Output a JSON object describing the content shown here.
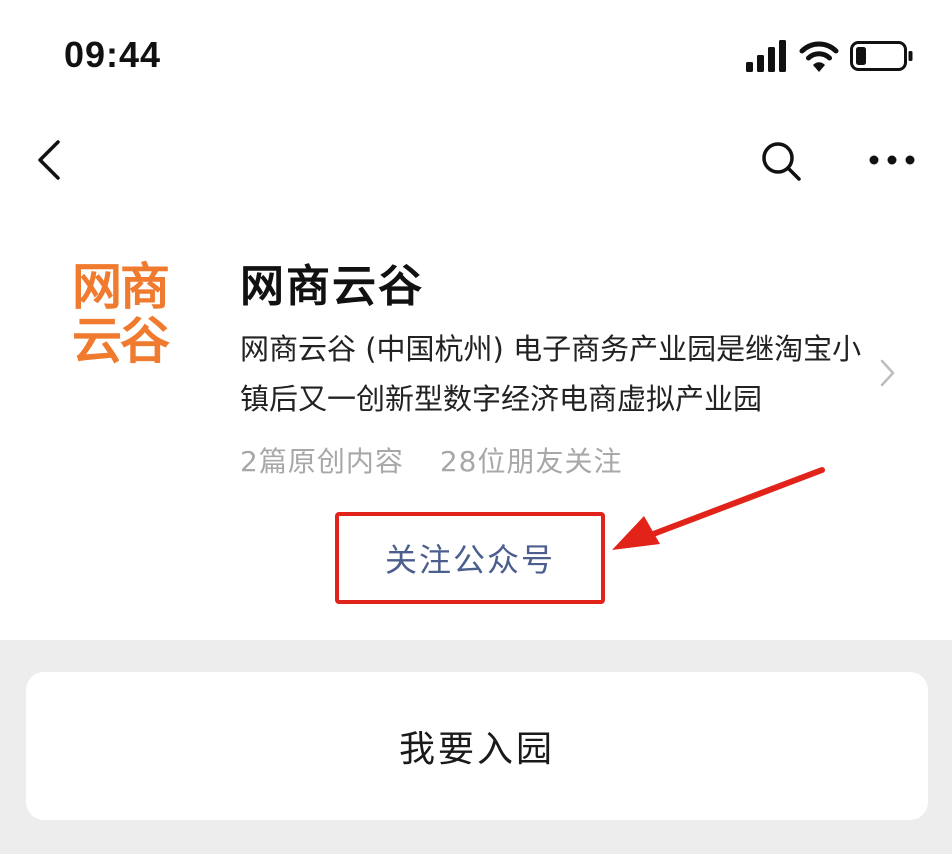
{
  "status_bar": {
    "time": "09:44",
    "icons": [
      "signal-icon",
      "wifi-icon",
      "battery-icon"
    ]
  },
  "nav": {
    "back_icon": "back-chevron-icon",
    "search_icon": "search-icon",
    "more_icon": "more-icon"
  },
  "account": {
    "logo_line1": "网商",
    "logo_line2": "云谷",
    "name": "网商云谷",
    "description": "网商云谷 (中国杭州) 电子商务产业园是继淘宝小镇后又一创新型数字经济电商虚拟产业园",
    "stats": {
      "original": "2篇原创内容",
      "followers": "28位朋友关注"
    },
    "follow_label": "关注公众号"
  },
  "menu": {
    "join_label": "我要入园"
  },
  "colors": {
    "logo_orange": "#f07a2e",
    "highlight_red": "#e2231a",
    "link_blue": "#4b5e8d",
    "background_gray": "#ededed"
  }
}
